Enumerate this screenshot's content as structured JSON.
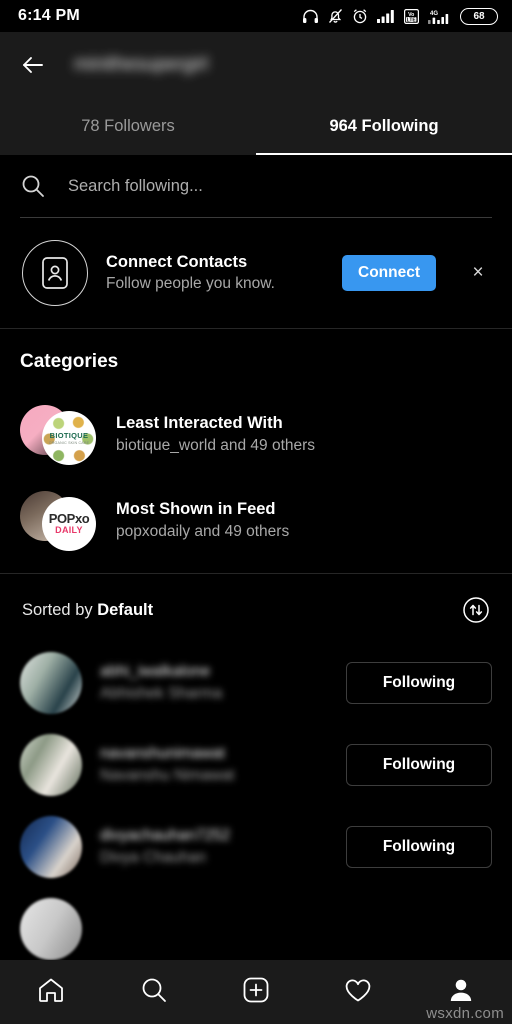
{
  "status_bar": {
    "time": "6:14 PM",
    "battery_level": "68",
    "icons": [
      "headphones-icon",
      "bell-muted-icon",
      "alarm-clock-icon",
      "signal-bars-icon",
      "volte-icon",
      "signal-4g-icon",
      "battery-icon"
    ]
  },
  "header": {
    "title": "minithesupergirl",
    "back_icon": "back-arrow-icon"
  },
  "tabs": [
    {
      "label": "78 Followers",
      "active": false
    },
    {
      "label": "964 Following",
      "active": true
    }
  ],
  "search": {
    "placeholder": "Search following...",
    "value": "",
    "icon": "search-icon"
  },
  "connect_contacts": {
    "title": "Connect Contacts",
    "subtitle": "Follow people you know.",
    "button_label": "Connect",
    "button_color": "#3897f0",
    "dismiss_label": "×",
    "icon": "contact-card-icon"
  },
  "categories": {
    "heading": "Categories",
    "items": [
      {
        "title": "Least Interacted With",
        "subtitle": "biotique_world and 49 others",
        "badge_main": "BIOTIQUE",
        "badge_sub": "ORGANIC SKIN CARE"
      },
      {
        "title": "Most Shown in Feed",
        "subtitle": "popxodaily and 49 others",
        "badge_main": "POPxo",
        "badge_sub": "DAILY"
      }
    ]
  },
  "sort": {
    "prefix": "Sorted by ",
    "value": "Default",
    "icon": "sort-arrows-icon"
  },
  "users": [
    {
      "handle": "abhi_iwalkalone",
      "name": "Abhishek Sharma",
      "button_label": "Following"
    },
    {
      "handle": "navanshunimawat",
      "name": "Navanshu Nimawat",
      "button_label": "Following"
    },
    {
      "handle": "divyachauhan7252",
      "name": "Divya Chauhan",
      "button_label": "Following"
    }
  ],
  "bottom_nav": [
    {
      "icon": "home-icon",
      "active": false
    },
    {
      "icon": "search-icon",
      "active": false
    },
    {
      "icon": "add-post-icon",
      "active": false
    },
    {
      "icon": "heart-icon",
      "active": false
    },
    {
      "icon": "profile-icon",
      "active": true
    }
  ],
  "watermark": "wsxdn.com"
}
